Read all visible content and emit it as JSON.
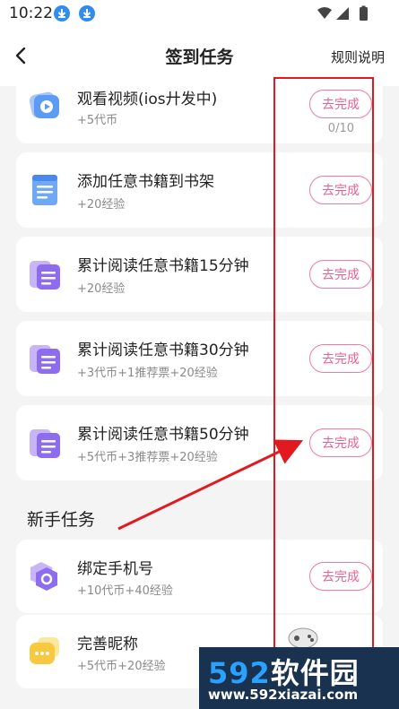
{
  "status_bar": {
    "time": "10:22"
  },
  "nav": {
    "title": "签到任务",
    "rules_label": "规则说明"
  },
  "tasks": [
    {
      "title": "观看视频(ios廾发中)",
      "reward": "+5代币",
      "button": "去完成",
      "progress": "0/10",
      "icon": "video-play-icon"
    },
    {
      "title": "添加任意书籍到书架",
      "reward": "+20经验",
      "button": "去完成",
      "icon": "document-icon"
    },
    {
      "title": "累计阅读任意书籍15分钟",
      "reward": "+20经验",
      "button": "去完成",
      "icon": "book-stack-icon"
    },
    {
      "title": "累计阅读任意书籍30分钟",
      "reward": "+3代币+1推荐票+20经验",
      "button": "去完成",
      "icon": "book-stack-icon"
    },
    {
      "title": "累计阅读任意书籍50分钟",
      "reward": "+5代币+3推荐票+20经验",
      "button": "去完成",
      "icon": "book-stack-icon"
    }
  ],
  "newbie_section": {
    "heading": "新手任务",
    "tasks": [
      {
        "title": "绑定手机号",
        "reward": "+10代币+40经验",
        "button": "去完成",
        "icon": "phone-hexagon-icon"
      },
      {
        "title": "完善昵称",
        "reward": "+5代币+20经验",
        "icon": "chat-bubble-icon"
      }
    ]
  },
  "watermark": {
    "brand_num": "592",
    "brand_text": "软件园",
    "url": "www.592xiazai.com"
  },
  "colors": {
    "accent_pink": "#ee5f8e",
    "annotation_red": "#e11a22",
    "icon_purple": "#8e6cf0",
    "icon_blue": "#4a90f0",
    "icon_yellow": "#f7c840"
  }
}
